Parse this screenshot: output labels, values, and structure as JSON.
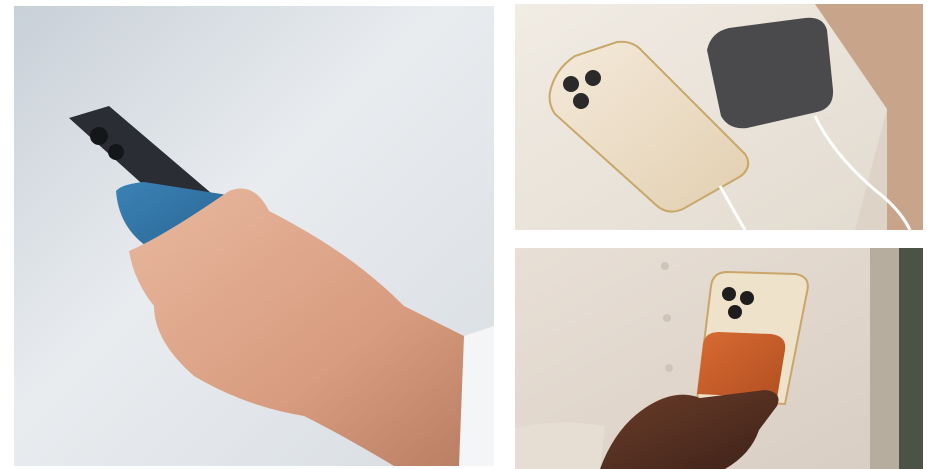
{
  "collage": {
    "panels": [
      {
        "id": "left",
        "subject": "hand-holding-phone-with-blue-wallet",
        "accent": "#2f6d99"
      },
      {
        "id": "top-right",
        "subject": "gold-phone-and-gray-wallet-charging-on-table",
        "accent": "#4a4a4c"
      },
      {
        "id": "bottom-right",
        "subject": "hand-holding-phone-with-orange-wallet",
        "accent": "#c25a28"
      }
    ]
  },
  "colors": {
    "background": "#ffffff",
    "blue_wallet": "#2f6d99",
    "gray_wallet": "#4a4a4c",
    "orange_wallet": "#c25a28",
    "gold_phone": "#e7d3a8"
  }
}
